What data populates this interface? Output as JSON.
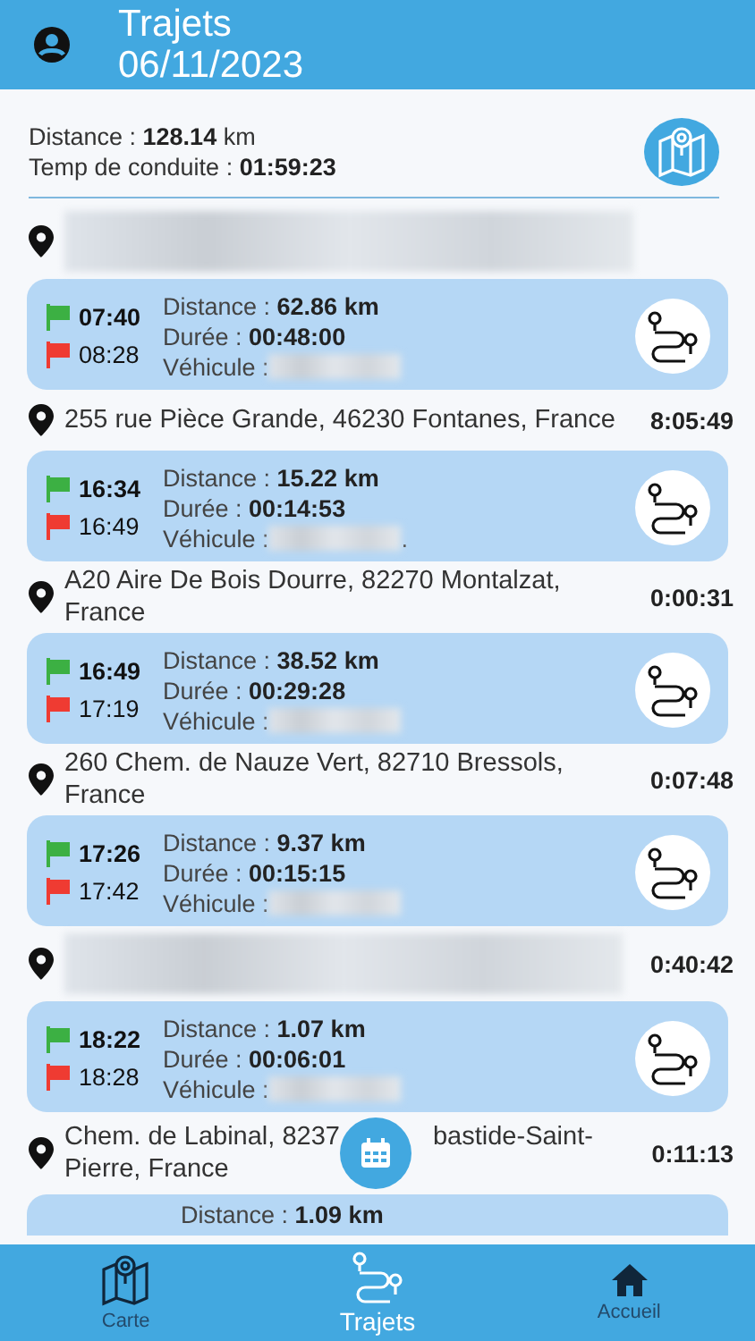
{
  "header": {
    "title": "Trajets",
    "date": "06/11/2023"
  },
  "summary": {
    "distance_label": "Distance : ",
    "distance_value": "128.14",
    "distance_unit": " km",
    "duration_label": "Temp de conduite : ",
    "duration_value": "01:59:23"
  },
  "timeline": [
    {
      "kind": "blurred_stop"
    },
    {
      "kind": "trip",
      "start": "07:40",
      "end": "08:28",
      "distance_label": "Distance : ",
      "distance": "62.86 km",
      "duration_label": "Durée : ",
      "duration": "00:48:00",
      "vehicle_label": "Véhicule : "
    },
    {
      "kind": "stop",
      "address": "255 rue Pièce Grande, 46230 Fontanes, France",
      "time": "8:05:49"
    },
    {
      "kind": "trip",
      "start": "16:34",
      "end": "16:49",
      "distance_label": "Distance : ",
      "distance": "15.22 km",
      "duration_label": "Durée : ",
      "duration": "00:14:53",
      "vehicle_label": "Véhicule : ",
      "vehicle_suffix": "."
    },
    {
      "kind": "stop",
      "address": "A20 Aire De Bois Dourre, 82270 Montalzat, France",
      "time": "0:00:31"
    },
    {
      "kind": "trip",
      "start": "16:49",
      "end": "17:19",
      "distance_label": "Distance : ",
      "distance": "38.52 km",
      "duration_label": "Durée : ",
      "duration": "00:29:28",
      "vehicle_label": "Véhicule : "
    },
    {
      "kind": "stop",
      "address": "260 Chem. de Nauze Vert, 82710 Bressols, France",
      "time": "0:07:48"
    },
    {
      "kind": "trip",
      "start": "17:26",
      "end": "17:42",
      "distance_label": "Distance : ",
      "distance": "9.37 km",
      "duration_label": "Durée : ",
      "duration": "00:15:15",
      "vehicle_label": "Véhicule : "
    },
    {
      "kind": "blurred_stop",
      "time": "0:40:42"
    },
    {
      "kind": "trip",
      "start": "18:22",
      "end": "18:28",
      "distance_label": "Distance : ",
      "distance": "1.07 km",
      "duration_label": "Durée : ",
      "duration": "00:06:01",
      "vehicle_label": "Véhicule : "
    },
    {
      "kind": "covered_stop",
      "address_parts": [
        "Chem. de Labinal, 8237",
        "bastide-Saint-",
        "Pierre, France"
      ],
      "time": "0:11:13"
    },
    {
      "kind": "trip_peek",
      "distance_label": "Distance : ",
      "distance": "1.09 km"
    }
  ],
  "nav": [
    {
      "label": "Carte",
      "selected": false
    },
    {
      "label": "Trajets",
      "selected": true
    },
    {
      "label": "Accueil",
      "selected": false
    }
  ]
}
